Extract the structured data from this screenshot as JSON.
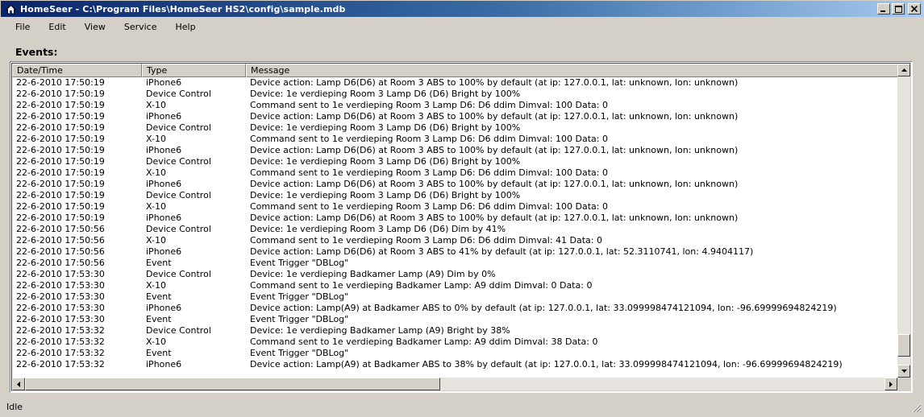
{
  "window": {
    "title": "HomeSeer - C:\\Program Files\\HomeSeer HS2\\config\\sample.mdb",
    "icon": "home-icon"
  },
  "menu": [
    "File",
    "Edit",
    "View",
    "Service",
    "Help"
  ],
  "events": {
    "label": "Events:",
    "columns": [
      "Date/Time",
      "Type",
      "Message"
    ],
    "rows": [
      [
        "22-6-2010 17:50:19",
        "iPhone6",
        "Device action: Lamp D6(D6) at Room 3 ABS to 100% by default (at ip: 127.0.0.1, lat: unknown, lon: unknown)"
      ],
      [
        "22-6-2010 17:50:19",
        "Device Control",
        "Device: 1e verdieping Room 3 Lamp D6 (D6) Bright by 100%"
      ],
      [
        "22-6-2010 17:50:19",
        "X-10",
        "Command sent to 1e verdieping Room 3 Lamp D6: D6 ddim Dimval: 100 Data: 0"
      ],
      [
        "22-6-2010 17:50:19",
        "iPhone6",
        "Device action: Lamp D6(D6) at Room 3 ABS to 100% by default (at ip: 127.0.0.1, lat: unknown, lon: unknown)"
      ],
      [
        "22-6-2010 17:50:19",
        "Device Control",
        "Device: 1e verdieping Room 3 Lamp D6 (D6) Bright by 100%"
      ],
      [
        "22-6-2010 17:50:19",
        "X-10",
        "Command sent to 1e verdieping Room 3 Lamp D6: D6 ddim Dimval: 100 Data: 0"
      ],
      [
        "22-6-2010 17:50:19",
        "iPhone6",
        "Device action: Lamp D6(D6) at Room 3 ABS to 100% by default (at ip: 127.0.0.1, lat: unknown, lon: unknown)"
      ],
      [
        "22-6-2010 17:50:19",
        "Device Control",
        "Device: 1e verdieping Room 3 Lamp D6 (D6) Bright by 100%"
      ],
      [
        "22-6-2010 17:50:19",
        "X-10",
        "Command sent to 1e verdieping Room 3 Lamp D6: D6 ddim Dimval: 100 Data: 0"
      ],
      [
        "22-6-2010 17:50:19",
        "iPhone6",
        "Device action: Lamp D6(D6) at Room 3 ABS to 100% by default (at ip: 127.0.0.1, lat: unknown, lon: unknown)"
      ],
      [
        "22-6-2010 17:50:19",
        "Device Control",
        "Device: 1e verdieping Room 3 Lamp D6 (D6) Bright by 100%"
      ],
      [
        "22-6-2010 17:50:19",
        "X-10",
        "Command sent to 1e verdieping Room 3 Lamp D6: D6 ddim Dimval: 100 Data: 0"
      ],
      [
        "22-6-2010 17:50:19",
        "iPhone6",
        "Device action: Lamp D6(D6) at Room 3 ABS to 100% by default (at ip: 127.0.0.1, lat: unknown, lon: unknown)"
      ],
      [
        "22-6-2010 17:50:56",
        "Device Control",
        "Device: 1e verdieping Room 3 Lamp D6 (D6) Dim by 41%"
      ],
      [
        "22-6-2010 17:50:56",
        "X-10",
        "Command sent to 1e verdieping Room 3 Lamp D6: D6 ddim Dimval: 41 Data: 0"
      ],
      [
        "22-6-2010 17:50:56",
        "iPhone6",
        "Device action: Lamp D6(D6) at Room 3 ABS to 41% by default (at ip: 127.0.0.1, lat: 52.3110741, lon: 4.9404117)"
      ],
      [
        "22-6-2010 17:50:56",
        "Event",
        "Event Trigger \"DBLog\""
      ],
      [
        "22-6-2010 17:53:30",
        "Device Control",
        "Device: 1e verdieping Badkamer Lamp (A9) Dim by 0%"
      ],
      [
        "22-6-2010 17:53:30",
        "X-10",
        "Command sent to 1e verdieping Badkamer Lamp: A9 ddim Dimval: 0 Data: 0"
      ],
      [
        "22-6-2010 17:53:30",
        "Event",
        "Event Trigger \"DBLog\""
      ],
      [
        "22-6-2010 17:53:30",
        "iPhone6",
        "Device action: Lamp(A9) at Badkamer ABS to 0% by default (at ip: 127.0.0.1, lat: 33.099998474121094, lon: -96.69999694824219)"
      ],
      [
        "22-6-2010 17:53:30",
        "Event",
        "Event Trigger \"DBLog\""
      ],
      [
        "22-6-2010 17:53:32",
        "Device Control",
        "Device: 1e verdieping Badkamer Lamp (A9) Bright by 38%"
      ],
      [
        "22-6-2010 17:53:32",
        "X-10",
        "Command sent to 1e verdieping Badkamer Lamp: A9 ddim Dimval: 38 Data: 0"
      ],
      [
        "22-6-2010 17:53:32",
        "Event",
        "Event Trigger \"DBLog\""
      ],
      [
        "22-6-2010 17:53:32",
        "iPhone6",
        "Device action: Lamp(A9) at Badkamer ABS to 38% by default (at ip: 127.0.0.1, lat: 33.099998474121094, lon: -96.69999694824219)"
      ]
    ]
  },
  "scroll": {
    "vertical_position": 0.97,
    "horizontal_position": 0.0
  },
  "status": {
    "text": "Idle"
  }
}
